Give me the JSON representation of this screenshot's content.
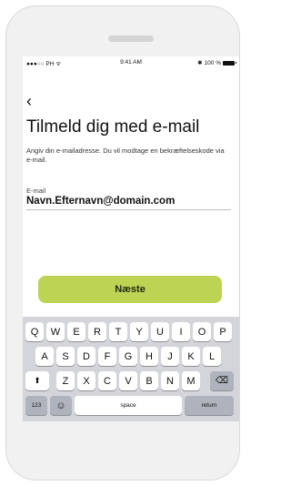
{
  "statusbar": {
    "carrier": "●●●○○ PH ᯤ",
    "time": "9:41 AM",
    "bluetooth": "✱",
    "battery": "100 %"
  },
  "back_icon": "‹",
  "title": "Tilmeld dig med e-mail",
  "description": "Angiv din e-mailadresse. Du vil modtage en bekræftelseskode via e-mail.",
  "email": {
    "label": "E-mail",
    "value": "Navn.Efternavn@domain.com"
  },
  "next_button": "Næste",
  "keyboard": {
    "row1": [
      "Q",
      "W",
      "E",
      "R",
      "T",
      "Y",
      "U",
      "I",
      "O",
      "P"
    ],
    "row2": [
      "A",
      "S",
      "D",
      "F",
      "G",
      "H",
      "J",
      "K",
      "L"
    ],
    "row3": [
      "Z",
      "X",
      "C",
      "V",
      "B",
      "N",
      "M"
    ],
    "shift": "⬆",
    "backspace": "⌫",
    "numbers": "123",
    "emoji": "☺",
    "space": "space",
    "return": "return"
  }
}
